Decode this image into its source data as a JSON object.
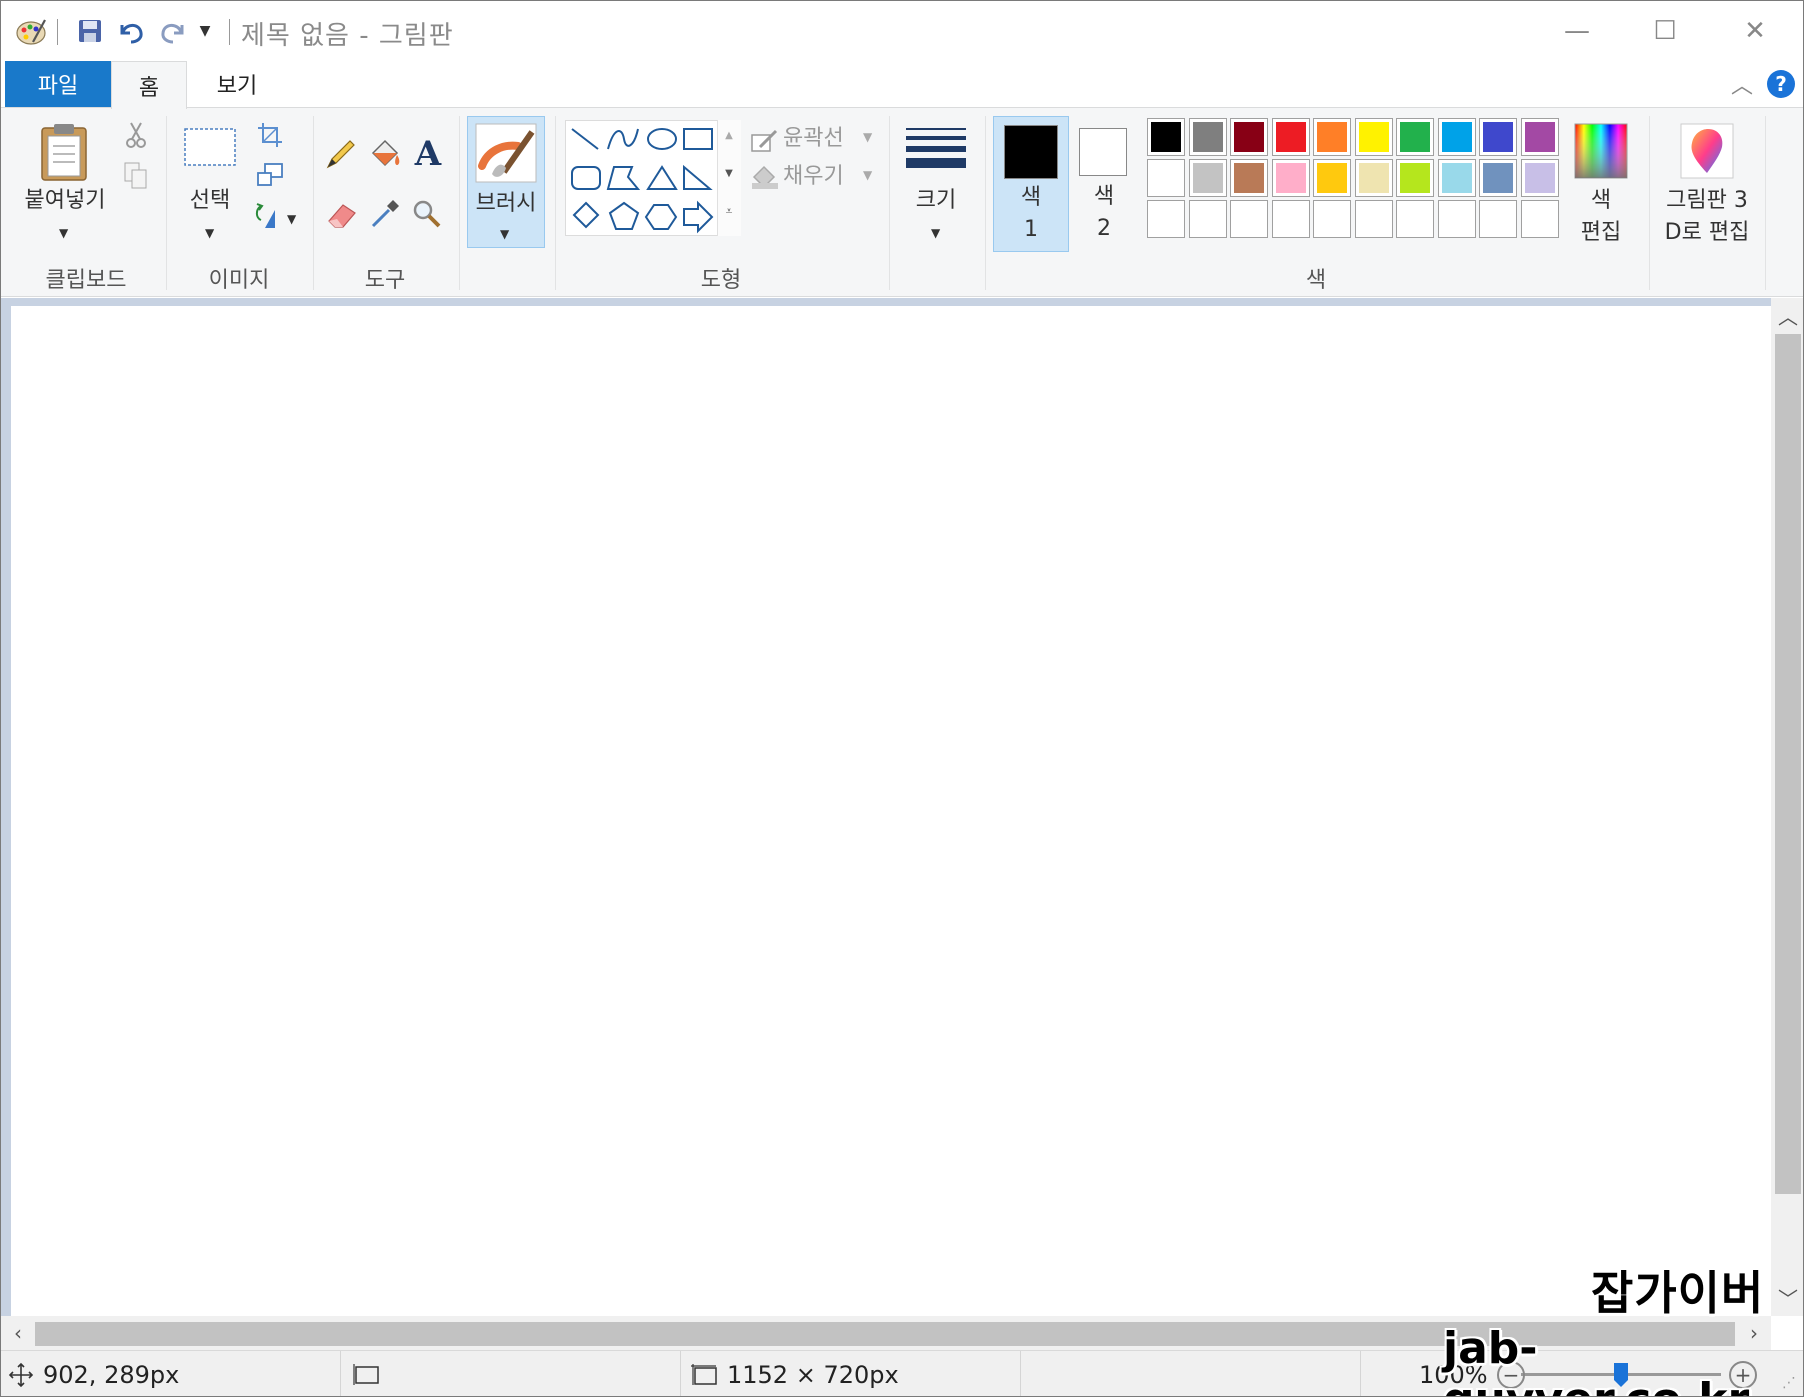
{
  "window": {
    "title": "제목 없음 - 그림판",
    "controls": {
      "minimize": "—",
      "maximize": "☐",
      "close": "✕"
    }
  },
  "quick_access": {
    "icons": [
      "paint-app-icon",
      "save-icon",
      "undo-icon",
      "redo-icon",
      "customize-dropdown-icon"
    ]
  },
  "tabs": [
    {
      "label": "파일",
      "active": false
    },
    {
      "label": "홈",
      "active": true
    },
    {
      "label": "보기",
      "active": false
    }
  ],
  "ribbon": {
    "clipboard": {
      "group_label": "클립보드",
      "paste_label": "붙여넣기"
    },
    "image": {
      "group_label": "이미지",
      "select_label": "선택"
    },
    "tools": {
      "group_label": "도구"
    },
    "brush": {
      "label": "브러시"
    },
    "shapes": {
      "group_label": "도형",
      "outline_label": "윤곽선",
      "fill_label": "채우기"
    },
    "size": {
      "label": "크기"
    },
    "colors": {
      "group_label": "색",
      "color1_label_top": "색",
      "color1_label_bottom": "1",
      "color2_label_top": "색",
      "color2_label_bottom": "2",
      "edit_colors_top": "색",
      "edit_colors_bottom": "편집",
      "color1": "#000000",
      "color2": "#ffffff",
      "palette_row1": [
        "#000000",
        "#7f7f7f",
        "#880015",
        "#ed1c24",
        "#ff7f27",
        "#fff200",
        "#22b14c",
        "#00a2e8",
        "#3f48cc",
        "#a349a4"
      ],
      "palette_row2": [
        "#ffffff",
        "#c3c3c3",
        "#b97a57",
        "#ffaec9",
        "#ffc90e",
        "#efe4b0",
        "#b5e61d",
        "#99d9ea",
        "#7092be",
        "#c8bfe7"
      ],
      "palette_row3": [
        "#ffffff",
        "#ffffff",
        "#ffffff",
        "#ffffff",
        "#ffffff",
        "#ffffff",
        "#ffffff",
        "#ffffff",
        "#ffffff",
        "#ffffff"
      ]
    },
    "paint3d": {
      "label_top": "그림판 3",
      "label_bottom": "D로 편집"
    }
  },
  "status": {
    "cursor_pos": "902, 289px",
    "canvas_size": "1152 × 720px",
    "zoom": "100%"
  },
  "watermark": {
    "line1": "잡가이버",
    "line2": "jab-guyver.co.kr"
  }
}
